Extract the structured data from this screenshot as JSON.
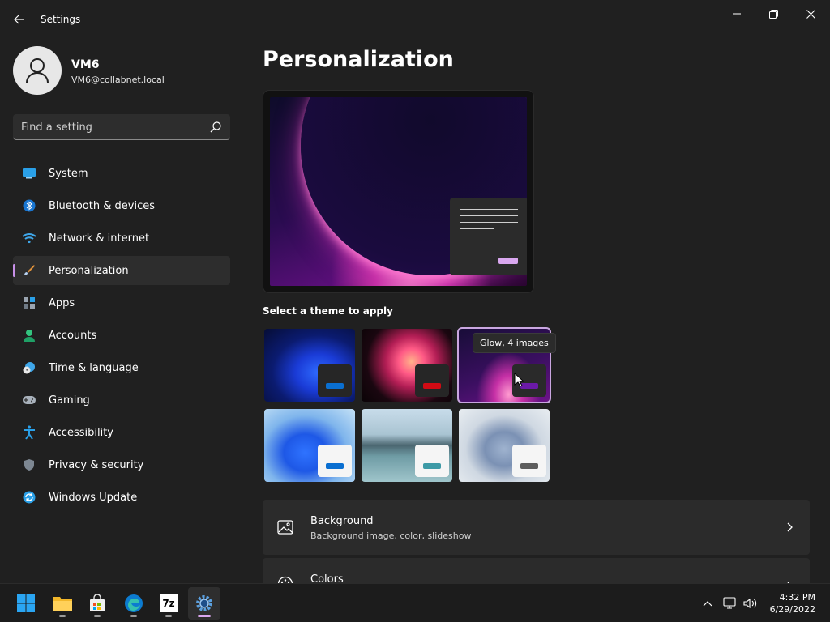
{
  "window": {
    "app_title": "Settings"
  },
  "profile": {
    "name": "VM6",
    "email": "VM6@collabnet.local"
  },
  "search": {
    "placeholder": "Find a setting"
  },
  "nav": {
    "items": [
      {
        "label": "System",
        "icon": "system-icon"
      },
      {
        "label": "Bluetooth & devices",
        "icon": "bluetooth-icon"
      },
      {
        "label": "Network & internet",
        "icon": "wifi-icon"
      },
      {
        "label": "Personalization",
        "icon": "brush-icon",
        "active": true
      },
      {
        "label": "Apps",
        "icon": "apps-icon"
      },
      {
        "label": "Accounts",
        "icon": "person-icon"
      },
      {
        "label": "Time & language",
        "icon": "clock-globe-icon"
      },
      {
        "label": "Gaming",
        "icon": "gamepad-icon"
      },
      {
        "label": "Accessibility",
        "icon": "accessibility-icon"
      },
      {
        "label": "Privacy & security",
        "icon": "shield-icon"
      },
      {
        "label": "Windows Update",
        "icon": "update-icon"
      }
    ]
  },
  "main": {
    "title": "Personalization",
    "theme_section_label": "Select a theme to apply",
    "tooltip": "Glow, 4 images",
    "themes": [
      {
        "name": "windows-dark",
        "accent": "#0a6fd1"
      },
      {
        "name": "captured-motion",
        "accent": "#d10b14"
      },
      {
        "name": "glow",
        "accent": "#6b1aa8",
        "selected": true
      },
      {
        "name": "windows-light",
        "accent": "#0a6fd1"
      },
      {
        "name": "sunrise",
        "accent": "#3d9aa6"
      },
      {
        "name": "flow",
        "accent": "#5d5d5d"
      }
    ],
    "rows": [
      {
        "title": "Background",
        "subtitle": "Background image, color, slideshow",
        "icon": "image-icon"
      },
      {
        "title": "Colors",
        "icon": "palette-icon"
      }
    ]
  },
  "taskbar": {
    "time": "4:32 PM",
    "date": "6/29/2022",
    "apps": [
      "start-icon",
      "file-explorer-icon",
      "store-icon",
      "edge-icon",
      "7zip-icon",
      "settings-icon"
    ],
    "seven_zip_label": "7z"
  },
  "colors": {
    "accent": "#c790e8",
    "background": "#202020",
    "card": "#2b2b2b"
  }
}
